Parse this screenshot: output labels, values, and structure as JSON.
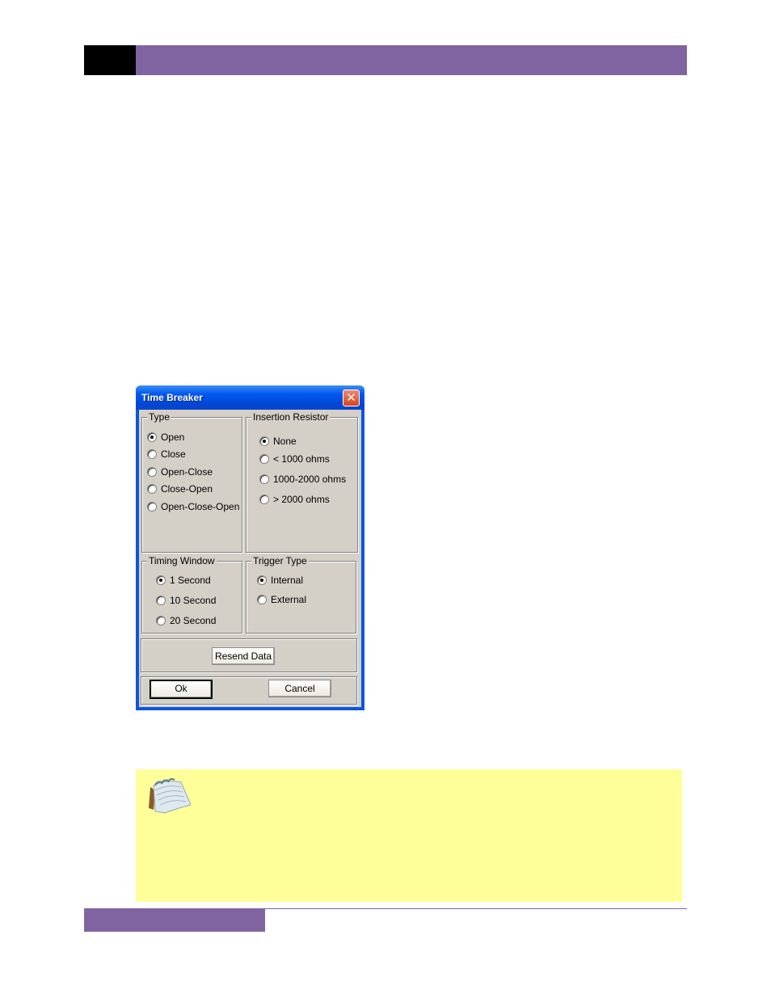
{
  "dialog": {
    "title": "Time Breaker",
    "close_glyph": "✕",
    "groups": {
      "type": {
        "label": "Type",
        "options": [
          {
            "label": "Open",
            "checked": true
          },
          {
            "label": "Close",
            "checked": false
          },
          {
            "label": "Open-Close",
            "checked": false
          },
          {
            "label": "Close-Open",
            "checked": false
          },
          {
            "label": "Open-Close-Open",
            "checked": false
          }
        ]
      },
      "insertion_resistor": {
        "label": "Insertion Resistor",
        "options": [
          {
            "label": "None",
            "checked": true
          },
          {
            "label": "< 1000 ohms",
            "checked": false
          },
          {
            "label": "1000-2000 ohms",
            "checked": false
          },
          {
            "label": "> 2000 ohms",
            "checked": false
          }
        ]
      },
      "timing_window": {
        "label": "Timing Window",
        "options": [
          {
            "label": "1 Second",
            "checked": true
          },
          {
            "label": "10 Second",
            "checked": false
          },
          {
            "label": "20 Second",
            "checked": false
          }
        ]
      },
      "trigger_type": {
        "label": "Trigger Type",
        "options": [
          {
            "label": "Internal",
            "checked": true
          },
          {
            "label": "External",
            "checked": false
          }
        ]
      }
    },
    "buttons": {
      "resend": "Resend Data",
      "ok": "Ok",
      "cancel": "Cancel"
    }
  },
  "note": {
    "icon": "notepad-icon"
  },
  "colors": {
    "header_bar": "#8064a2",
    "header_block": "#000000",
    "note_background": "#ffff99",
    "dialog_face": "#d4d0c8",
    "titlebar_blue": "#0058ee"
  }
}
